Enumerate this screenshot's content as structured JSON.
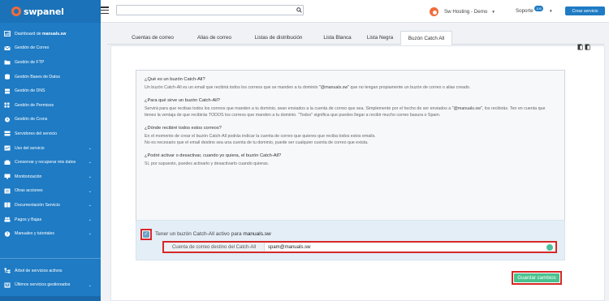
{
  "brand": {
    "name": "swpanel",
    "color": "#1e7bc4",
    "accent": "#f26b3a"
  },
  "sidebar": {
    "items": [
      {
        "label": "Dashboard de ",
        "bold": "manuals.sw",
        "icon": "dashboard-icon",
        "chevron": false
      },
      {
        "label": "Gestión de Correo",
        "icon": "mail-icon",
        "chevron": false
      },
      {
        "label": "Gestión de FTP",
        "icon": "folder-icon",
        "chevron": false
      },
      {
        "label": "Gestión Bases de Datos",
        "icon": "database-icon",
        "chevron": false
      },
      {
        "label": "Gestión de DNS",
        "icon": "globe-icon",
        "chevron": false
      },
      {
        "label": "Gestión de Permisos",
        "icon": "permissions-icon",
        "chevron": false
      },
      {
        "label": "Gestión de Crons",
        "icon": "clock-icon",
        "chevron": false
      },
      {
        "label": "Servidores del servicio",
        "icon": "server-icon",
        "chevron": false
      },
      {
        "label": "Uso del servicio",
        "icon": "chart-icon",
        "chevron": true
      },
      {
        "label": "Conservar y recuperar mis datos",
        "icon": "backup-icon",
        "chevron": true
      },
      {
        "label": "Monitorización",
        "icon": "monitor-icon",
        "chevron": true
      },
      {
        "label": "Otras acciones",
        "icon": "actions-icon",
        "chevron": true
      },
      {
        "label": "Documentación Servicio",
        "icon": "book-icon",
        "chevron": true
      },
      {
        "label": "Pagos y Bajas",
        "icon": "payments-icon",
        "chevron": true
      },
      {
        "label": "Manuales y tutoriales",
        "icon": "help-icon",
        "chevron": true
      }
    ],
    "bottom_items": [
      {
        "label": "Árbol de servicios activos",
        "icon": "tree-icon",
        "chevron": false
      },
      {
        "label": "Últimos servicios gestionados",
        "icon": "recent-icon",
        "chevron": true
      }
    ]
  },
  "topbar": {
    "search_value": "",
    "user_name": "Sw Hosting - Demo",
    "support_label": "Soporte",
    "support_badge": "100",
    "new_service_label": "Crear servicio"
  },
  "tabs": [
    {
      "label": "Cuentas de correo",
      "active": false
    },
    {
      "label": "Alias de correo",
      "active": false
    },
    {
      "label": "Listas de distribución",
      "active": false
    },
    {
      "label": "Lista Blanca",
      "active": false
    },
    {
      "label": "Lista Negra",
      "active": false
    },
    {
      "label": "Buzón Catch All",
      "active": true
    }
  ],
  "faq": [
    {
      "q": "¿Qué es un buzón Catch-All?",
      "a_pre": "Un buzón Catch-All es un email que recibirá todos los correos que se manden a tu dominio ",
      "a_quote": "\"@manuals.sw\"",
      "a_post": " que no tengan propiamente un buzón de correo o alias creado."
    },
    {
      "q": "¿Para qué sirve un buzón Catch-All?",
      "a_pre": "Servirá para que recibas todos los correos que manden a tu dominio, sean enviados a la cuenta de correo que sea. Simplemente por el hecho de ser enviados a ",
      "a_quote": "\"@manuals.sw\"",
      "a_post": ", los recibirás. Ten en cuenta que tienes la ventaja de que recibirás TODOS los correos que manden a tu dominio. \"Todos\" significa que puedes llegar a recibir mucho correo basura o Spam."
    },
    {
      "q": "¿Dónde recibiré todos estos correos?",
      "a_pre": "En el momento de crear el buzón Catch-All podrás indicar la cuenta de correo que quieres que reciba todos estos emails.\nNo es necesario que el email destino sea una cuenta de tu dominio, puede ser cualquier cuenta de correo que exista.",
      "a_quote": "",
      "a_post": ""
    },
    {
      "q": "¿Podré activar o desactivar, cuando yo quiera, el buzón Catch-All?",
      "a_pre": "Sí, por supuesto, puedes activarlo y desactivarlo cuando quieras.",
      "a_quote": "",
      "a_post": ""
    }
  ],
  "catch_all": {
    "enabled": true,
    "checkbox_label": "Tener un buzón Catch-All activo para ",
    "domain": "manuals.sw",
    "dest_label": "Cuenta de correo destino del Catch-All",
    "dest_value": "spam@manuals.sw"
  },
  "save_label": "Guardar cambios"
}
